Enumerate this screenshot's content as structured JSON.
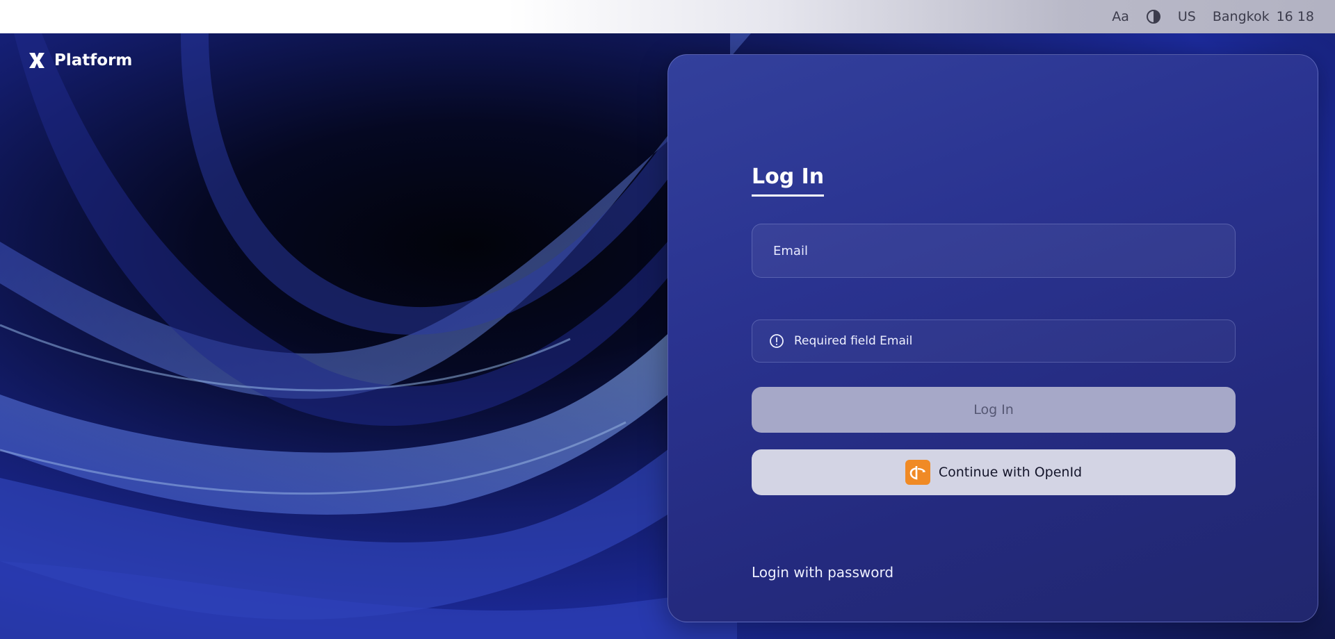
{
  "topbar": {
    "font_label": "Aa",
    "contrast_icon": "contrast-icon",
    "language": "US",
    "clock_city": "Bangkok",
    "clock_time": "16 18"
  },
  "brand": {
    "name": "Platform",
    "logo_icon": "platform-logo-icon"
  },
  "login": {
    "tab_title": "Log In",
    "email_placeholder": "Email",
    "email_value": "",
    "error_message": "Required field Email",
    "login_button": "Log In",
    "openid_button": "Continue with OpenId",
    "password_link": "Login with password"
  },
  "colors": {
    "card_bg": "#2a3390",
    "login_button_bg": "#a6a8c8",
    "openid_button_bg": "#d3d4e4",
    "openid_accent": "#f08a25"
  }
}
